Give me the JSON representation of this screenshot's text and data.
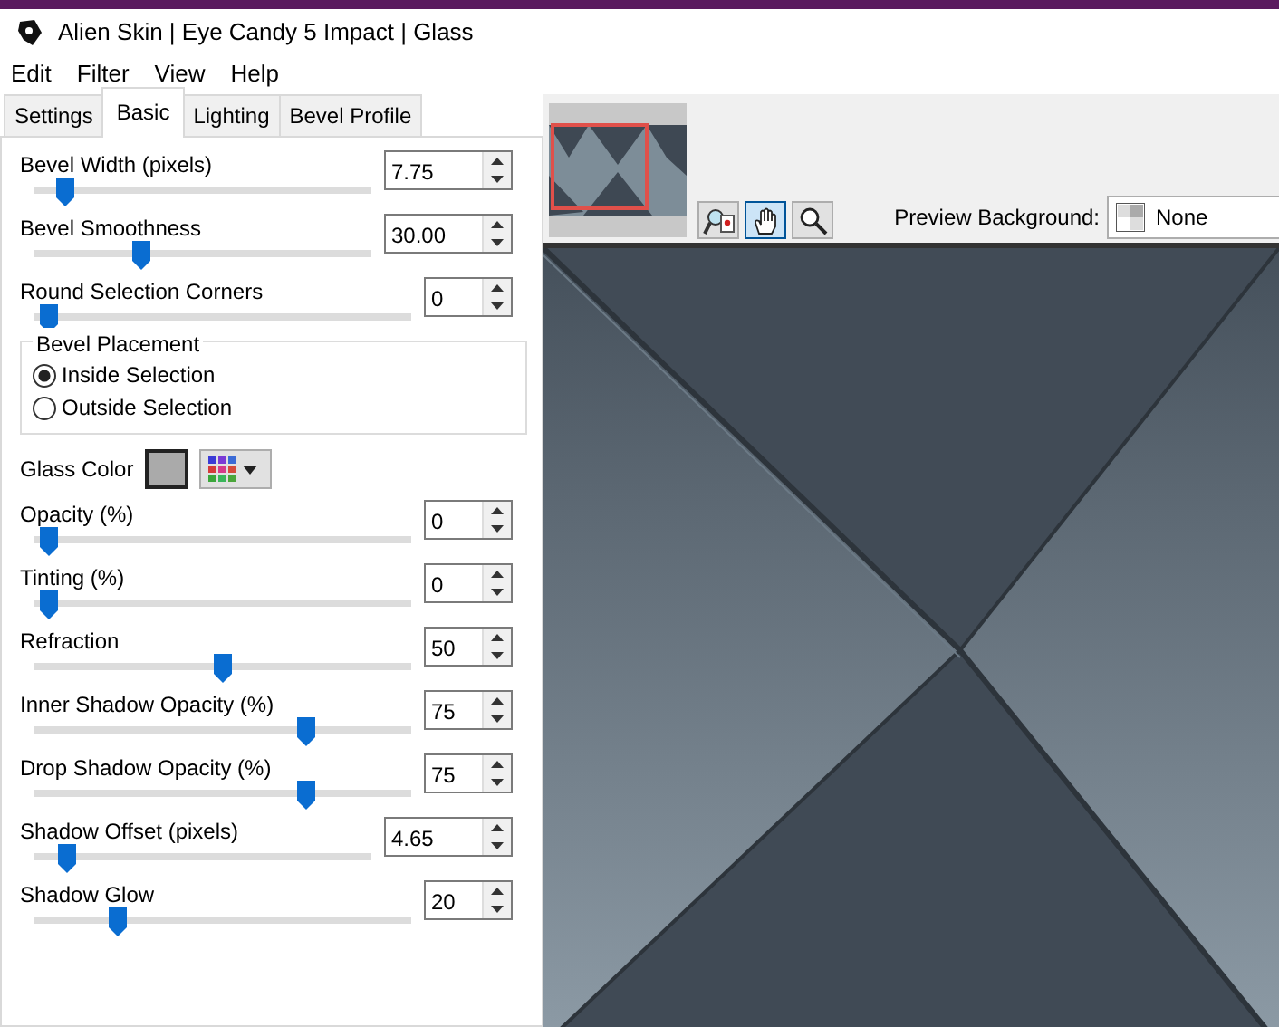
{
  "window": {
    "title": "Alien Skin | Eye Candy 5 Impact | Glass"
  },
  "menu": [
    "Edit",
    "Filter",
    "View",
    "Help"
  ],
  "tabs": [
    {
      "label": "Settings",
      "selected": false
    },
    {
      "label": "Basic",
      "selected": true
    },
    {
      "label": "Lighting",
      "selected": false
    },
    {
      "label": "Bevel Profile",
      "selected": false
    }
  ],
  "controls": [
    {
      "kind": "slider",
      "label": "Bevel Width (pixels)",
      "value": "7.75",
      "level": 0.05
    },
    {
      "kind": "slider",
      "label": "Bevel Smoothness",
      "value": "30.00",
      "level": 0.3
    },
    {
      "kind": "slider",
      "label": "Round Selection Corners",
      "value": "0",
      "level": 0
    },
    {
      "kind": "group",
      "label": "Bevel Placement",
      "options": [
        {
          "label": "Inside Selection",
          "selected": true
        },
        {
          "label": "Outside Selection",
          "selected": false
        }
      ]
    },
    {
      "kind": "color",
      "label": "Glass Color",
      "color": "#aaaaaa"
    },
    {
      "kind": "slider",
      "label": "Opacity (%)",
      "value": "0",
      "level": 0
    },
    {
      "kind": "slider",
      "label": "Tinting (%)",
      "value": "0",
      "level": 0
    },
    {
      "kind": "slider",
      "label": "Refraction",
      "value": "50",
      "level": 0.5
    },
    {
      "kind": "slider",
      "label": "Inner Shadow Opacity (%)",
      "value": "75",
      "level": 0.74
    },
    {
      "kind": "slider",
      "label": "Drop Shadow Opacity (%)",
      "value": "75",
      "level": 0.74
    },
    {
      "kind": "slider",
      "label": "Shadow Offset (pixels)",
      "value": "4.65",
      "level": 0.06
    },
    {
      "kind": "slider",
      "label": "Shadow Glow",
      "value": "20",
      "level": 0.2
    }
  ],
  "tools": [
    {
      "kind": "preview-mode",
      "selected": false
    },
    {
      "kind": "hand",
      "selected": true
    },
    {
      "kind": "zoom",
      "selected": false
    }
  ],
  "preview_background": {
    "label": "Preview Background:",
    "value": "None"
  }
}
